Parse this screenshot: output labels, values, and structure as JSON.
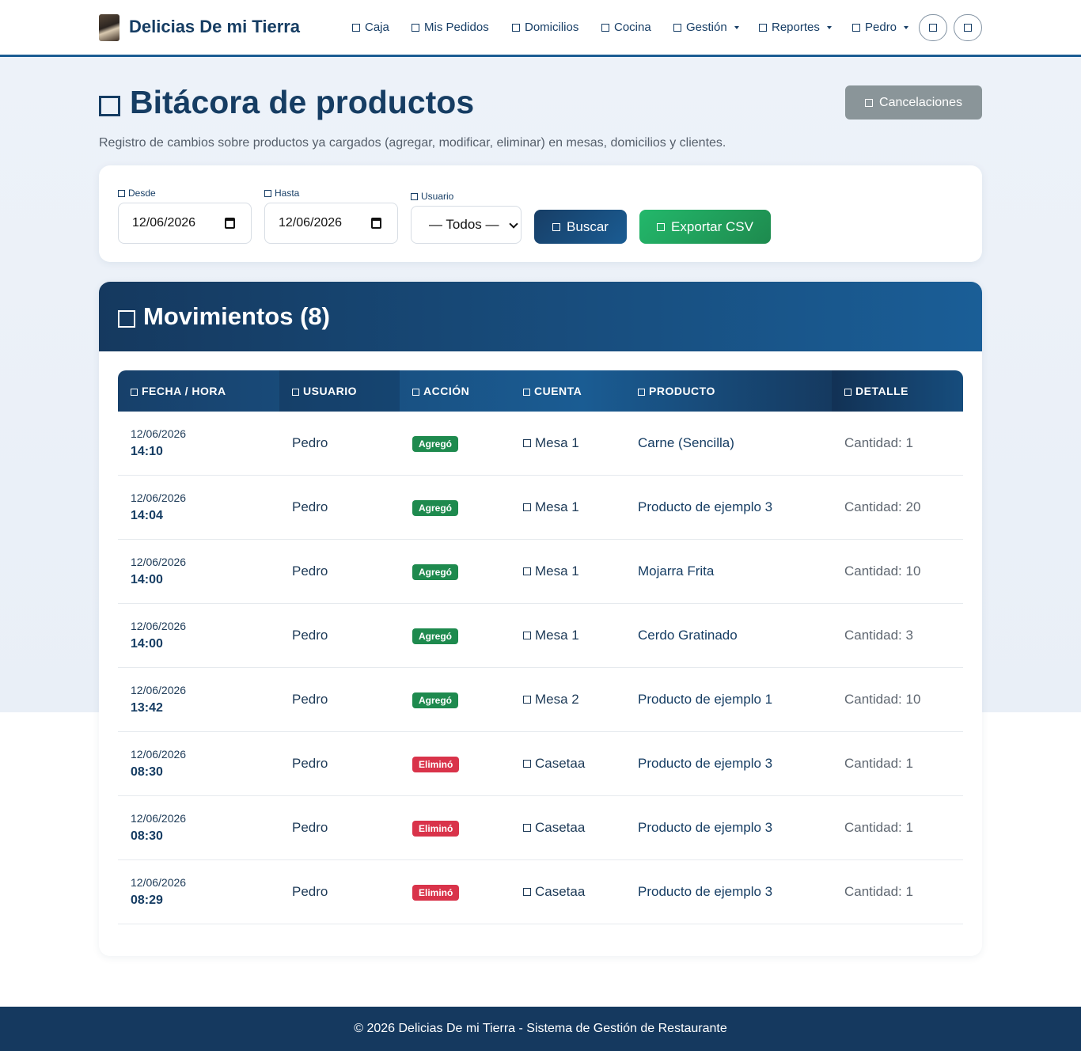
{
  "nav": {
    "brand": "Delicias De mi Tierra",
    "items": [
      {
        "label": "Caja"
      },
      {
        "label": "Mis Pedidos"
      },
      {
        "label": "Domicilios"
      },
      {
        "label": "Cocina"
      },
      {
        "label": "Gestión"
      },
      {
        "label": "Reportes"
      },
      {
        "label": "Pedro"
      }
    ]
  },
  "header": {
    "title": "Bitácora de productos",
    "subtitle": "Registro de cambios sobre productos ya cargados (agregar, modificar, eliminar) en mesas, domicilios y clientes.",
    "cancel_label": "Cancelaciones"
  },
  "filters": {
    "desde_label": "Desde",
    "desde_value": "12/06/2026",
    "hasta_label": "Hasta",
    "hasta_value": "12/06/2026",
    "usuario_label": "Usuario",
    "usuario_value": "— Todos —",
    "buscar_label": "Buscar",
    "export_label": "Exportar CSV"
  },
  "movements": {
    "title": "Movimientos (8)",
    "columns": [
      "FECHA / HORA",
      "USUARIO",
      "ACCIÓN",
      "CUENTA",
      "PRODUCTO",
      "DETALLE"
    ],
    "rows": [
      {
        "date": "12/06/2026",
        "time": "14:10",
        "user": "Pedro",
        "action": "Agregó",
        "action_type": "add",
        "account": "Mesa 1",
        "product": "Carne (Sencilla)",
        "detail": "Cantidad: 1"
      },
      {
        "date": "12/06/2026",
        "time": "14:04",
        "user": "Pedro",
        "action": "Agregó",
        "action_type": "add",
        "account": "Mesa 1",
        "product": "Producto de ejemplo 3",
        "detail": "Cantidad: 20"
      },
      {
        "date": "12/06/2026",
        "time": "14:00",
        "user": "Pedro",
        "action": "Agregó",
        "action_type": "add",
        "account": "Mesa 1",
        "product": "Mojarra Frita",
        "detail": "Cantidad: 10"
      },
      {
        "date": "12/06/2026",
        "time": "14:00",
        "user": "Pedro",
        "action": "Agregó",
        "action_type": "add",
        "account": "Mesa 1",
        "product": "Cerdo Gratinado",
        "detail": "Cantidad: 3"
      },
      {
        "date": "12/06/2026",
        "time": "13:42",
        "user": "Pedro",
        "action": "Agregó",
        "action_type": "add",
        "account": "Mesa 2",
        "product": "Producto de ejemplo 1",
        "detail": "Cantidad: 10"
      },
      {
        "date": "12/06/2026",
        "time": "08:30",
        "user": "Pedro",
        "action": "Eliminó",
        "action_type": "remove",
        "account": "Casetaa",
        "product": "Producto de ejemplo 3",
        "detail": "Cantidad: 1"
      },
      {
        "date": "12/06/2026",
        "time": "08:30",
        "user": "Pedro",
        "action": "Eliminó",
        "action_type": "remove",
        "account": "Casetaa",
        "product": "Producto de ejemplo 3",
        "detail": "Cantidad: 1"
      },
      {
        "date": "12/06/2026",
        "time": "08:29",
        "user": "Pedro",
        "action": "Eliminó",
        "action_type": "remove",
        "account": "Casetaa",
        "product": "Producto de ejemplo 3",
        "detail": "Cantidad: 1"
      }
    ]
  },
  "footer": {
    "text": "© 2026 Delicias De mi Tierra - Sistema de Gestión de Restaurante"
  },
  "colors": {
    "primary": "#163d63",
    "accent": "#1a5c93",
    "success": "#1e8a4e",
    "danger": "#d9334a",
    "muted_button": "#8a9599"
  },
  "icons": {
    "brand": "restaurant-logo",
    "nav": "square-icon",
    "action_buttons": [
      "theme-toggle-icon",
      "fullscreen-icon"
    ]
  }
}
